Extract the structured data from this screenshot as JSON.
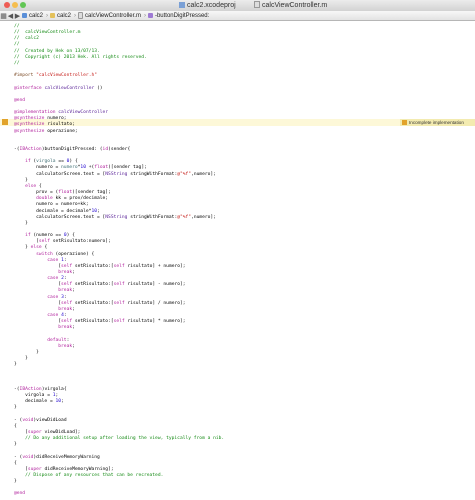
{
  "window": {
    "tabs": [
      {
        "label": "calc2.xcodeproj"
      },
      {
        "label": "calcViewController.m"
      }
    ]
  },
  "jumpbar": {
    "crumbs": [
      {
        "label": "calc2",
        "icon": "project-icon"
      },
      {
        "label": "calc2",
        "icon": "folder-icon"
      },
      {
        "label": "calcViewController.m",
        "icon": "file-icon"
      },
      {
        "label": "-buttonDigitPressed:",
        "icon": "method-icon"
      }
    ]
  },
  "warning": {
    "text": "Incomplete implementation"
  },
  "code": [
    [
      [
        "c",
        "//"
      ]
    ],
    [
      [
        "c",
        "//  calcViewController.m"
      ]
    ],
    [
      [
        "c",
        "//  calc2"
      ]
    ],
    [
      [
        "c",
        "//"
      ]
    ],
    [
      [
        "c",
        "//  Created by Hek on 13/07/13."
      ]
    ],
    [
      [
        "c",
        "//  Copyright (c) 2013 Hek. All rights reserved."
      ]
    ],
    [
      [
        "c",
        "//"
      ]
    ],
    [],
    [
      [
        "p",
        "#import "
      ],
      [
        "s",
        "\"calcViewController.h\""
      ]
    ],
    [],
    [
      [
        "k",
        "@interface"
      ],
      [
        "n",
        " "
      ],
      [
        "t",
        "calcViewController"
      ],
      [
        "n",
        " ()"
      ]
    ],
    [],
    [
      [
        "k",
        "@end"
      ]
    ],
    [],
    [
      [
        "k",
        "@implementation"
      ],
      [
        "n",
        " "
      ],
      [
        "t",
        "calcViewController"
      ]
    ],
    [
      [
        "k",
        "@synthesize"
      ],
      [
        "n",
        " numero;"
      ]
    ],
    [
      [
        "k",
        "@synthesize"
      ],
      [
        "n",
        " risultato;"
      ]
    ],
    [
      [
        "k",
        "@synthesize"
      ],
      [
        "n",
        " operazione;"
      ]
    ],
    [],
    [],
    [
      [
        "n",
        "-("
      ],
      [
        "k",
        "IBAction"
      ],
      [
        "n",
        ")buttonDigitPressed: ("
      ],
      [
        "k",
        "id"
      ],
      [
        "n",
        ")sender{"
      ]
    ],
    [],
    [
      [
        "n",
        "    "
      ],
      [
        "k",
        "if"
      ],
      [
        "n",
        " ("
      ],
      [
        "m",
        "virgola"
      ],
      [
        "n",
        " == "
      ],
      [
        "d",
        "0"
      ],
      [
        "n",
        ") {"
      ]
    ],
    [
      [
        "n",
        "        numero = "
      ],
      [
        "m",
        "numero"
      ],
      [
        "n",
        "*"
      ],
      [
        "d",
        "10"
      ],
      [
        "n",
        " +("
      ],
      [
        "k",
        "float"
      ],
      [
        "n",
        ")[sender tag];"
      ]
    ],
    [
      [
        "n",
        "        calculatorScreen.text = ["
      ],
      [
        "t",
        "NSString"
      ],
      [
        "n",
        " stringWithFormat:"
      ],
      [
        "s",
        "@\"%f\""
      ],
      [
        "n",
        ",numero];"
      ]
    ],
    [
      [
        "n",
        "    }"
      ]
    ],
    [
      [
        "n",
        "    "
      ],
      [
        "k",
        "else"
      ],
      [
        "n",
        " {"
      ]
    ],
    [
      [
        "n",
        "        prov = ("
      ],
      [
        "k",
        "float"
      ],
      [
        "n",
        ")[sender tag];"
      ]
    ],
    [
      [
        "n",
        "        "
      ],
      [
        "k",
        "double"
      ],
      [
        "n",
        " kk = prov/decimale;"
      ]
    ],
    [
      [
        "n",
        "        numero = numero+kk;"
      ]
    ],
    [
      [
        "n",
        "        decimale = decimale*"
      ],
      [
        "d",
        "10"
      ],
      [
        "n",
        ";"
      ]
    ],
    [
      [
        "n",
        "        calculatorScreen.text = ["
      ],
      [
        "t",
        "NSString"
      ],
      [
        "n",
        " stringWithFormat:"
      ],
      [
        "s",
        "@\"%f\""
      ],
      [
        "n",
        ",numero];"
      ]
    ],
    [
      [
        "n",
        "    }"
      ]
    ],
    [],
    [
      [
        "n",
        "    "
      ],
      [
        "k",
        "if"
      ],
      [
        "n",
        " (numero == "
      ],
      [
        "d",
        "0"
      ],
      [
        "n",
        ") {"
      ]
    ],
    [
      [
        "n",
        "        ["
      ],
      [
        "k",
        "self"
      ],
      [
        "n",
        " setRisultato:numero];"
      ]
    ],
    [
      [
        "n",
        "    } "
      ],
      [
        "k",
        "else"
      ],
      [
        "n",
        " {"
      ]
    ],
    [
      [
        "n",
        "        "
      ],
      [
        "k",
        "switch"
      ],
      [
        "n",
        " (operazione) {"
      ]
    ],
    [
      [
        "n",
        "            "
      ],
      [
        "k",
        "case"
      ],
      [
        "n",
        " "
      ],
      [
        "d",
        "1"
      ],
      [
        "n",
        ":"
      ]
    ],
    [
      [
        "n",
        "                ["
      ],
      [
        "k",
        "self"
      ],
      [
        "n",
        " setRisultato:["
      ],
      [
        "k",
        "self"
      ],
      [
        "n",
        " risultato] + numero];"
      ]
    ],
    [
      [
        "n",
        "                "
      ],
      [
        "k",
        "break"
      ],
      [
        "n",
        ";"
      ]
    ],
    [
      [
        "n",
        "            "
      ],
      [
        "k",
        "case"
      ],
      [
        "n",
        " "
      ],
      [
        "d",
        "2"
      ],
      [
        "n",
        ":"
      ]
    ],
    [
      [
        "n",
        "                ["
      ],
      [
        "k",
        "self"
      ],
      [
        "n",
        " setRisultato:["
      ],
      [
        "k",
        "self"
      ],
      [
        "n",
        " risultato] - numero];"
      ]
    ],
    [
      [
        "n",
        "                "
      ],
      [
        "k",
        "break"
      ],
      [
        "n",
        ";"
      ]
    ],
    [
      [
        "n",
        "            "
      ],
      [
        "k",
        "case"
      ],
      [
        "n",
        " "
      ],
      [
        "d",
        "3"
      ],
      [
        "n",
        ":"
      ]
    ],
    [
      [
        "n",
        "                ["
      ],
      [
        "k",
        "self"
      ],
      [
        "n",
        " setRisultato:["
      ],
      [
        "k",
        "self"
      ],
      [
        "n",
        " risultato] / numero];"
      ]
    ],
    [
      [
        "n",
        "                "
      ],
      [
        "k",
        "break"
      ],
      [
        "n",
        ";"
      ]
    ],
    [
      [
        "n",
        "            "
      ],
      [
        "k",
        "case"
      ],
      [
        "n",
        " "
      ],
      [
        "d",
        "4"
      ],
      [
        "n",
        ":"
      ]
    ],
    [
      [
        "n",
        "                ["
      ],
      [
        "k",
        "self"
      ],
      [
        "n",
        " setRisultato:["
      ],
      [
        "k",
        "self"
      ],
      [
        "n",
        " risultato] * numero];"
      ]
    ],
    [
      [
        "n",
        "                "
      ],
      [
        "k",
        "break"
      ],
      [
        "n",
        ";"
      ]
    ],
    [],
    [
      [
        "n",
        "            "
      ],
      [
        "k",
        "default"
      ],
      [
        "n",
        ":"
      ]
    ],
    [
      [
        "n",
        "                "
      ],
      [
        "k",
        "break"
      ],
      [
        "n",
        ";"
      ]
    ],
    [
      [
        "n",
        "        }"
      ]
    ],
    [
      [
        "n",
        "    }"
      ]
    ],
    [
      [
        "n",
        "}"
      ]
    ],
    [],
    [],
    [],
    [
      [
        "n",
        "-("
      ],
      [
        "k",
        "IBAction"
      ],
      [
        "n",
        ")virgola{"
      ]
    ],
    [
      [
        "n",
        "    virgola = "
      ],
      [
        "d",
        "1"
      ],
      [
        "n",
        ";"
      ]
    ],
    [
      [
        "n",
        "    decimale = "
      ],
      [
        "d",
        "10"
      ],
      [
        "n",
        ";"
      ]
    ],
    [
      [
        "n",
        "}"
      ]
    ],
    [],
    [
      [
        "n",
        "- ("
      ],
      [
        "k",
        "void"
      ],
      [
        "n",
        ")viewDidLoad"
      ]
    ],
    [
      [
        "n",
        "{"
      ]
    ],
    [
      [
        "n",
        "    ["
      ],
      [
        "k",
        "super"
      ],
      [
        "n",
        " viewDidLoad];"
      ]
    ],
    [
      [
        "c",
        "    // Do any additional setup after loading the view, typically from a nib."
      ]
    ],
    [
      [
        "n",
        "}"
      ]
    ],
    [],
    [
      [
        "n",
        "- ("
      ],
      [
        "k",
        "void"
      ],
      [
        "n",
        ")didReceiveMemoryWarning"
      ]
    ],
    [
      [
        "n",
        "{"
      ]
    ],
    [
      [
        "n",
        "    ["
      ],
      [
        "k",
        "super"
      ],
      [
        "n",
        " didReceiveMemoryWarning];"
      ]
    ],
    [
      [
        "c",
        "    // Dispose of any resources that can be recreated."
      ]
    ],
    [
      [
        "n",
        "}"
      ]
    ],
    [],
    [
      [
        "k",
        "@end"
      ]
    ]
  ]
}
